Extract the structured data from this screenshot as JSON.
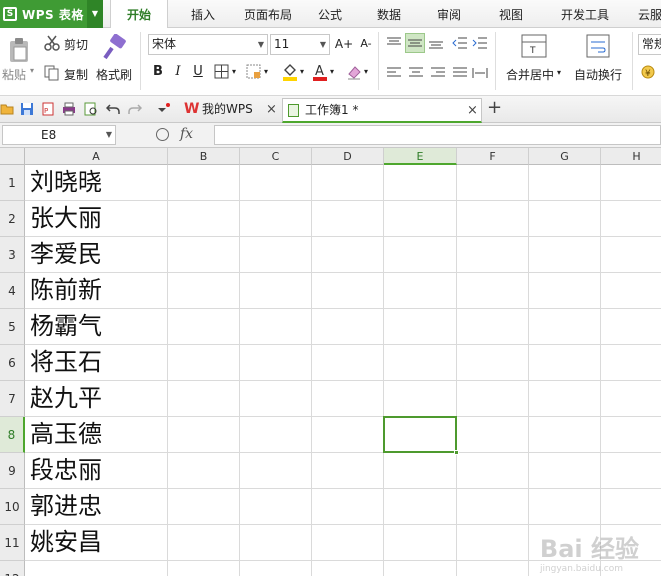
{
  "app": {
    "logo": "S",
    "name": "WPS 表格",
    "menu_arrow": "▼"
  },
  "menu_tabs": [
    "开始",
    "插入",
    "页面布局",
    "公式",
    "数据",
    "审阅",
    "视图",
    "开发工具",
    "云服"
  ],
  "ribbon": {
    "paste": "粘贴",
    "cut": "剪切",
    "copy": "复制",
    "format_painter": "格式刷",
    "font_name": "宋体",
    "font_size": "11",
    "bold": "B",
    "italic": "I",
    "underline": "U",
    "grow_font": "A+",
    "shrink_font": "A-",
    "merge_center": "合并居中",
    "wrap_text": "自动换行",
    "number_format": "常规",
    "accent_color": "#3f9b34"
  },
  "doc_tabs": [
    {
      "label": "我的WPS",
      "close": "×"
    },
    {
      "label": "工作簿1 *",
      "close": "×"
    }
  ],
  "new_tab": "+",
  "formula_bar": {
    "name_box": "E8",
    "fx": "fx",
    "value": ""
  },
  "sheet": {
    "columns": [
      "A",
      "B",
      "C",
      "D",
      "E",
      "F",
      "G",
      "H"
    ],
    "rows": [
      "1",
      "2",
      "3",
      "4",
      "5",
      "6",
      "7",
      "8",
      "9",
      "10",
      "11",
      "12"
    ],
    "column_a_values": [
      "刘晓晓",
      "张大丽",
      "李爱民",
      "陈前新",
      "杨霸气",
      "将玉石",
      "赵九平",
      "高玉德",
      "段忠丽",
      "郭进忠",
      "姚安昌",
      ""
    ],
    "selected_cell": "E8"
  },
  "watermark": {
    "text": "Bai 经验",
    "sub": "jingyan.baidu.com"
  }
}
